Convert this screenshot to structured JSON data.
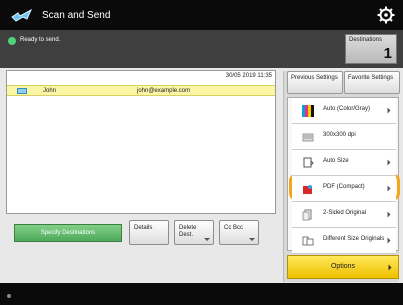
{
  "app": {
    "title": "Scan and Send",
    "icon": "scan-send-icon"
  },
  "status": {
    "text": "Ready to send.",
    "destinations_label": "Destinations",
    "destinations_count": "1"
  },
  "destination_list": {
    "timestamp": "30/05 2019 11:35",
    "rows": [
      {
        "name": "John",
        "email": "john@example.com"
      }
    ]
  },
  "left_buttons": {
    "specify": "Specify Destinations",
    "details": "Details",
    "delete": "Delete\nDest.",
    "cc": "Cc\nBcc"
  },
  "right_panel": {
    "previous": "Previous\nSettings",
    "favorite": "Favorite\nSettings",
    "settings": [
      {
        "label": "Auto (Color/Gray)",
        "icon": "color-icon"
      },
      {
        "label": "300x300 dpi",
        "icon": "resolution-icon"
      },
      {
        "label": "Auto Size",
        "icon": "scan-size-icon"
      },
      {
        "label": "PDF (Compact)",
        "icon": "pdf-icon"
      },
      {
        "label": "2-Sided Original",
        "icon": "duplex-icon"
      },
      {
        "label": "Different Size\nOriginals",
        "icon": "mixed-size-icon"
      }
    ],
    "options": "Options"
  },
  "colors": {
    "accent_highlight": "#f3a51c",
    "title_bg": "#0a0a0a",
    "status_green": "#4cd37b"
  }
}
